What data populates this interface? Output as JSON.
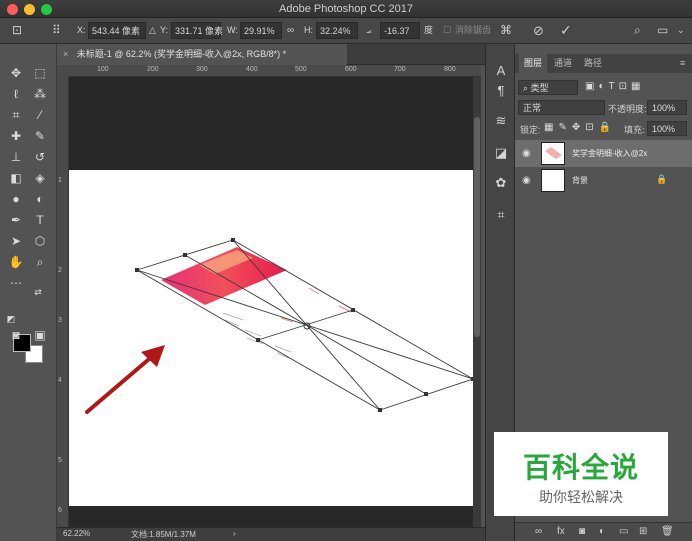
{
  "window": {
    "title": "Adobe Photoshop CC 2017"
  },
  "options_bar": {
    "x_label": "X:",
    "x_value": "543.44 像素",
    "y_label": "Y:",
    "y_value": "331.71 像素",
    "w_label": "W:",
    "w_value": "29.91%",
    "h_label": "H:",
    "h_value": "32.24%",
    "angle_value": "-16.37",
    "angle_unit": "度",
    "interp_label": "消除锯齿"
  },
  "document": {
    "tab_title": "未标题-1 @ 62.2% (奖学金明细-收入@2x, RGB/8*) *",
    "ruler_h": [
      "100",
      "200",
      "300",
      "400",
      "500",
      "600",
      "700",
      "800"
    ],
    "ruler_v": [
      "1",
      "2",
      "3",
      "4",
      "5",
      "6"
    ]
  },
  "status_bar": {
    "zoom": "62.22%",
    "doc_info": "文档:1.85M/1.37M"
  },
  "layers_panel": {
    "tabs": [
      "图层",
      "通道",
      "路径"
    ],
    "filter_label": "类型",
    "blend_mode": "正常",
    "opacity_label": "不透明度:",
    "opacity_value": "100%",
    "lock_label": "锁定:",
    "fill_label": "填充:",
    "fill_value": "100%",
    "layers": [
      {
        "name": "奖学金明细-收入@2x",
        "visible": true,
        "active": true
      },
      {
        "name": "背景",
        "visible": true,
        "locked": true
      }
    ]
  },
  "watermark": {
    "title": "百科全说",
    "subtitle": "助你轻松解决"
  },
  "colors": {
    "accent": "#27a83b",
    "arrow": "#b01818",
    "panel": "#535353"
  }
}
